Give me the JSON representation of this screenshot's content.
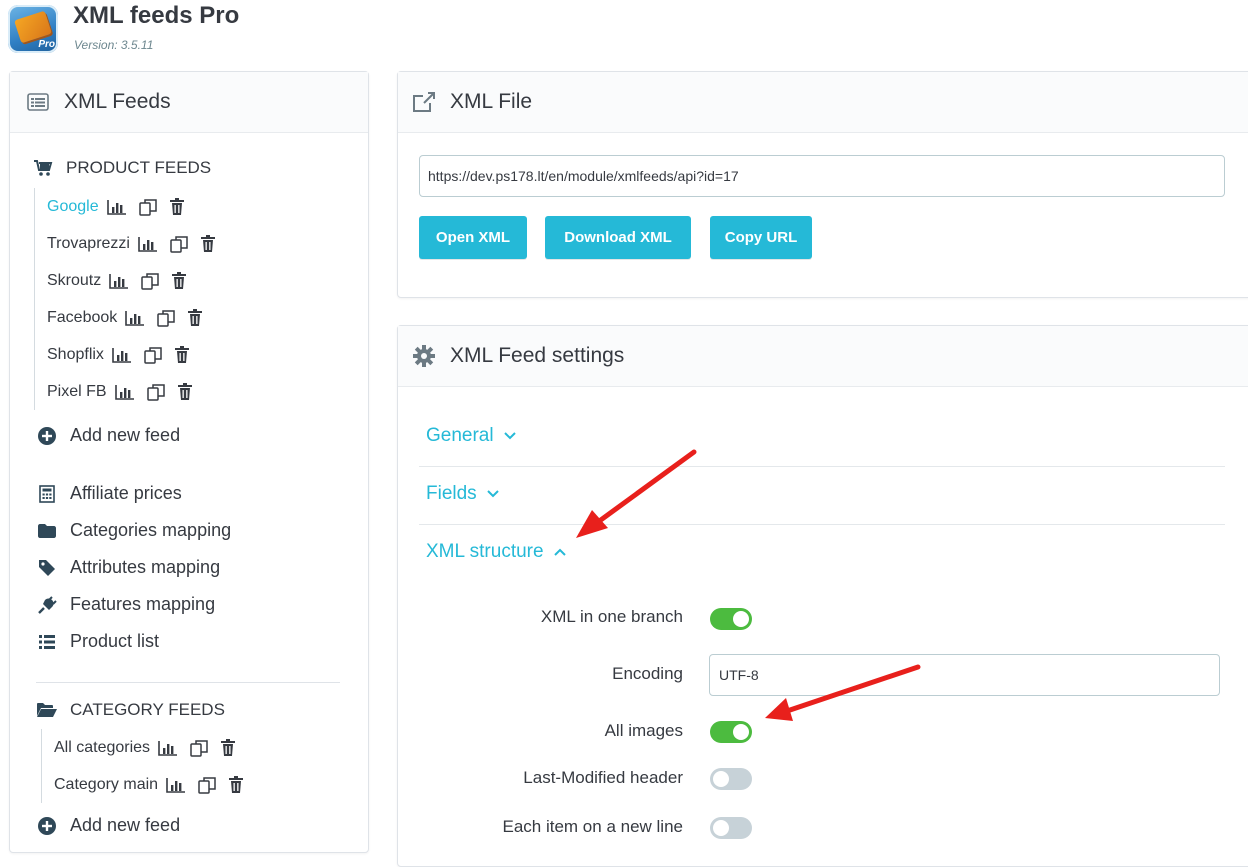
{
  "app": {
    "title": "XML feeds Pro",
    "version": "Version: 3.5.11",
    "logo_text": "Pro"
  },
  "sidebar": {
    "title": "XML Feeds",
    "product_section": "PRODUCT FEEDS",
    "product_feeds": [
      {
        "name": "Google",
        "active": true
      },
      {
        "name": "Trovaprezzi",
        "active": false
      },
      {
        "name": "Skroutz",
        "active": false
      },
      {
        "name": "Facebook",
        "active": false
      },
      {
        "name": "Shopflix",
        "active": false
      },
      {
        "name": "Pixel FB",
        "active": false
      }
    ],
    "add_product_feed": "Add new feed",
    "links": [
      {
        "label": "Affiliate prices",
        "icon": "calculator-icon"
      },
      {
        "label": "Categories mapping",
        "icon": "folder-icon"
      },
      {
        "label": "Attributes mapping",
        "icon": "tag-icon"
      },
      {
        "label": "Features mapping",
        "icon": "plug-icon"
      },
      {
        "label": "Product list",
        "icon": "list-icon"
      }
    ],
    "category_section": "CATEGORY FEEDS",
    "category_feeds": [
      {
        "name": "All categories"
      },
      {
        "name": "Category main"
      }
    ],
    "add_category_feed": "Add new feed"
  },
  "xml_file": {
    "title": "XML File",
    "url": "https://dev.ps178.lt/en/module/xmlfeeds/api?id=17",
    "buttons": {
      "open": "Open XML",
      "download": "Download XML",
      "copy": "Copy URL"
    }
  },
  "settings": {
    "title": "XML Feed settings",
    "sections": {
      "general": "General",
      "fields": "Fields",
      "xml_structure": "XML structure"
    },
    "rows": {
      "one_branch": {
        "label": "XML in one branch",
        "value": true
      },
      "encoding": {
        "label": "Encoding",
        "value": "UTF-8"
      },
      "all_images": {
        "label": "All images",
        "value": true
      },
      "last_modified": {
        "label": "Last-Modified header",
        "value": false
      },
      "new_line": {
        "label": "Each item on a new line",
        "value": false
      }
    }
  },
  "colors": {
    "accent": "#25b9d7",
    "toggle_on": "#4cbb3f",
    "toggle_off": "#c7d2d8",
    "annotation_arrow": "#e8201c"
  }
}
